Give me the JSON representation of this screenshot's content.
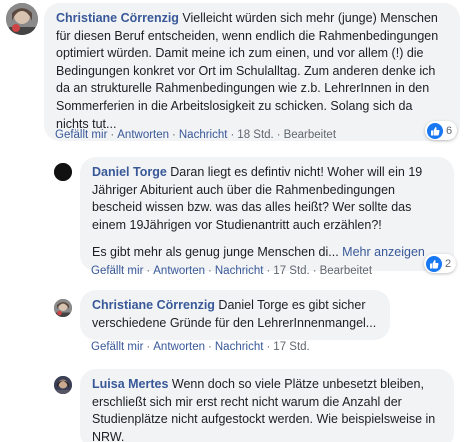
{
  "comments": [
    {
      "author": "Christiane Cörrenzig",
      "text": "Vielleicht würden sich mehr (junge) Menschen für diesen Beruf entscheiden, wenn endlich die Rahmenbedingungen optimiert würden. Damit meine ich zum einen, und vor allem (!) die Bedingungen konkret vor Ort im Schulalltag. Zum anderen denke ich da an strukturelle Rahmenbedingungen wie z.b. LehrerInnen in den Sommerferien in die Arbeitslosigkeit zu schicken. Solang sich da nichts tut...",
      "like_label": "Gefällt mir",
      "reply_label": "Antworten",
      "message_label": "Nachricht",
      "time": "18 Std.",
      "edited": "Bearbeitet",
      "reaction_count": "6"
    },
    {
      "author": "Daniel Torge",
      "text": "Daran liegt es defintiv nicht! Woher will ein 19 Jähriger Abiturient auch über die Rahmenbedingungen bescheid wissen bzw. was das alles heißt? Wer sollte das einem 19Jährigen vor Studienantritt auch erzählen?!",
      "text2": "Es gibt mehr als genug junge Menschen di...",
      "more_label": "Mehr anzeigen",
      "like_label": "Gefällt mir",
      "reply_label": "Antworten",
      "message_label": "Nachricht",
      "time": "17 Std.",
      "edited": "Bearbeitet",
      "reaction_count": "2"
    },
    {
      "author": "Christiane Cörrenzig",
      "text": "Daniel Torge es gibt sicher verschiedene Gründe für den LehrerInnenmangel...",
      "like_label": "Gefällt mir",
      "reply_label": "Antworten",
      "message_label": "Nachricht",
      "time": "17 Std."
    },
    {
      "author": "Luisa Mertes",
      "text": "Wenn doch so viele Plätze unbesetzt bleiben, erschließt sich mir erst recht nicht warum die Anzahl der Studienplätze nicht aufgestockt werden. Wie beispielsweise in NRW."
    }
  ],
  "colors": {
    "link": "#385898",
    "bubble": "#f2f3f5",
    "like": "#1877f2"
  },
  "icons": {
    "reaction": "thumbs-up-icon"
  }
}
